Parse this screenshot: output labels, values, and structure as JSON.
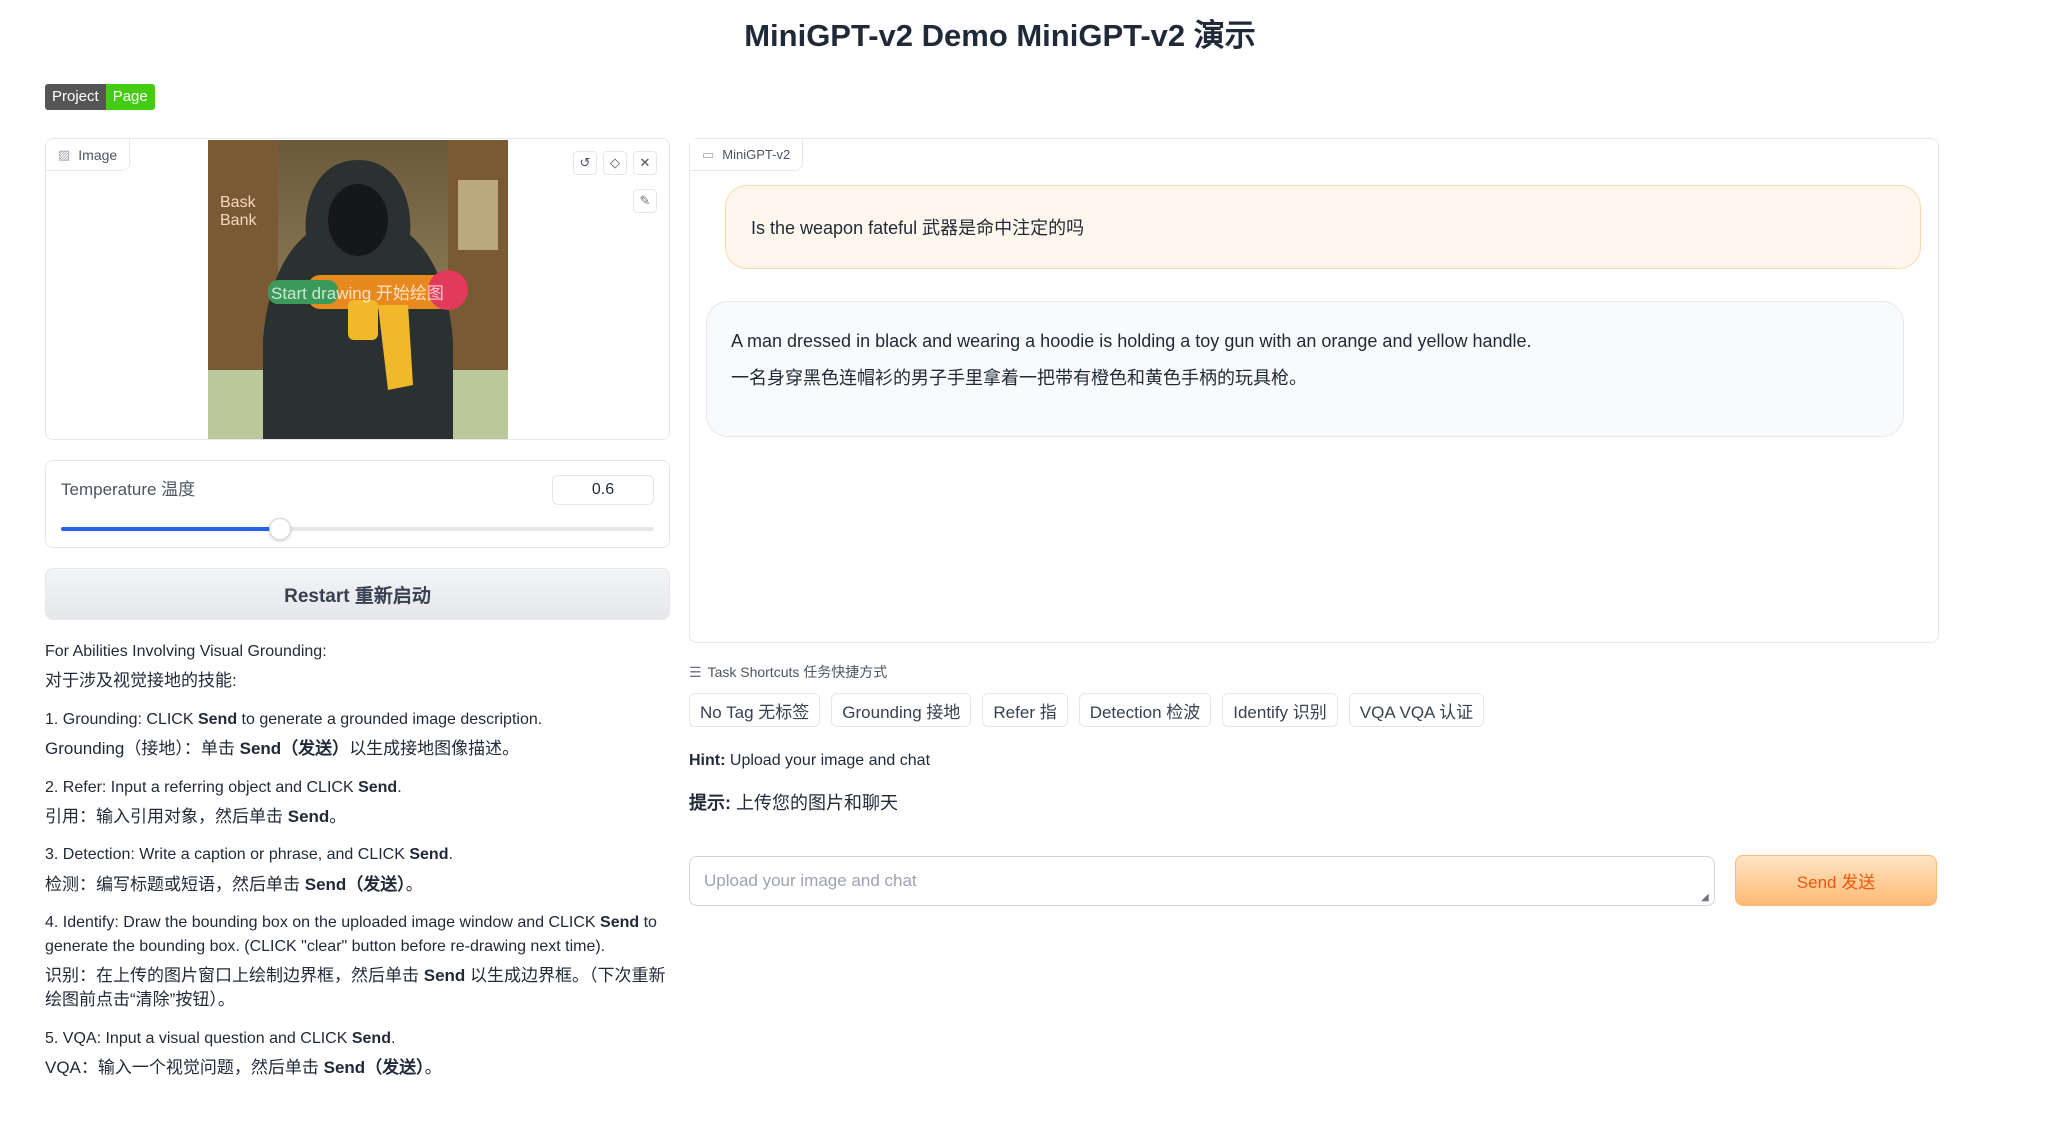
{
  "header": {
    "title": "MiniGPT-v2 Demo MiniGPT-v2 演示",
    "badge_left": "Project",
    "badge_right": "Page",
    "badge_left_color": "#555555",
    "badge_right_color": "#44cc11"
  },
  "image_panel": {
    "label": "Image",
    "draw_hint": "Start drawing 开始绘图",
    "photo_text_line1": "Bask",
    "photo_text_line2": "Bank",
    "tools": [
      "undo-icon",
      "eraser-icon",
      "close-icon",
      "brush-icon"
    ]
  },
  "temperature": {
    "label": "Temperature 温度",
    "value": "0.6",
    "slider_fraction": 0.37,
    "accent_color": "#2563eb"
  },
  "restart": {
    "label": "Restart 重新启动"
  },
  "instructions": {
    "intro_en": "For Abilities Involving Visual Grounding:",
    "intro_zh": "对于涉及视觉接地的技能:",
    "grounding_en_pre": "1. Grounding: CLICK ",
    "grounding_en_bold": "Send",
    "grounding_en_post": " to generate a grounded image description.",
    "grounding_zh_pre": "Grounding（接地）：单击 ",
    "grounding_zh_bold": "Send（发送）",
    "grounding_zh_post": "以生成接地图像描述。",
    "refer_en_pre": "2. Refer: Input a referring object and CLICK ",
    "refer_en_bold": "Send",
    "refer_en_post": ".",
    "refer_zh_pre": "引用：输入引用对象，然后单击 ",
    "refer_zh_bold": "Send",
    "refer_zh_post": "。",
    "detection_en_pre": "3. Detection: Write a caption or phrase, and CLICK ",
    "detection_en_bold": "Send",
    "detection_en_post": ".",
    "detection_zh_pre": "检测：编写标题或短语，然后单击 ",
    "detection_zh_bold": "Send（发送）",
    "detection_zh_post": "。",
    "identify_en_pre": "4. Identify: Draw the bounding box on the uploaded image window and CLICK ",
    "identify_en_bold": "Send",
    "identify_en_post": " to generate the bounding box. (CLICK \"clear\" button before re-drawing next time).",
    "identify_zh_pre": "识别：在上传的图片窗口上绘制边界框，然后单击 ",
    "identify_zh_bold": "Send",
    "identify_zh_post": " 以生成边界框。（下次重新绘图前点击“清除”按钮）。",
    "vqa_en_pre": "5. VQA: Input a visual question and CLICK ",
    "vqa_en_bold": "Send",
    "vqa_en_post": ".",
    "vqa_zh_pre": "VQA：输入一个视觉问题，然后单击 ",
    "vqa_zh_bold": "Send（发送）",
    "vqa_zh_post": "。"
  },
  "chat": {
    "label": "MiniGPT-v2",
    "user_message": "Is the weapon fateful 武器是命中注定的吗",
    "bot_message_en": "A man dressed in black and wearing a hoodie is holding a toy gun with an orange and yellow handle.",
    "bot_message_zh": "一名身穿黑色连帽衫的男子手里拿着一把带有橙色和黄色手柄的玩具枪。",
    "user_bubble_color": "#fff7ed",
    "bot_bubble_color": "#f9fafb"
  },
  "shortcuts": {
    "label": "Task Shortcuts 任务快捷方式",
    "items": [
      {
        "label": "No Tag 无标签"
      },
      {
        "label": "Grounding 接地"
      },
      {
        "label": "Refer 指"
      },
      {
        "label": "Detection 检波"
      },
      {
        "label": "Identify 识别"
      },
      {
        "label": "VQA VQA 认证"
      }
    ]
  },
  "hint": {
    "en_label": "Hint:",
    "en_text": " Upload your image and chat",
    "zh_label": "提示:",
    "zh_text": " 上传您的图片和聊天"
  },
  "input": {
    "placeholder": "Upload your image and chat",
    "value": ""
  },
  "send": {
    "label": "Send 发送",
    "color": "#ea580c"
  }
}
